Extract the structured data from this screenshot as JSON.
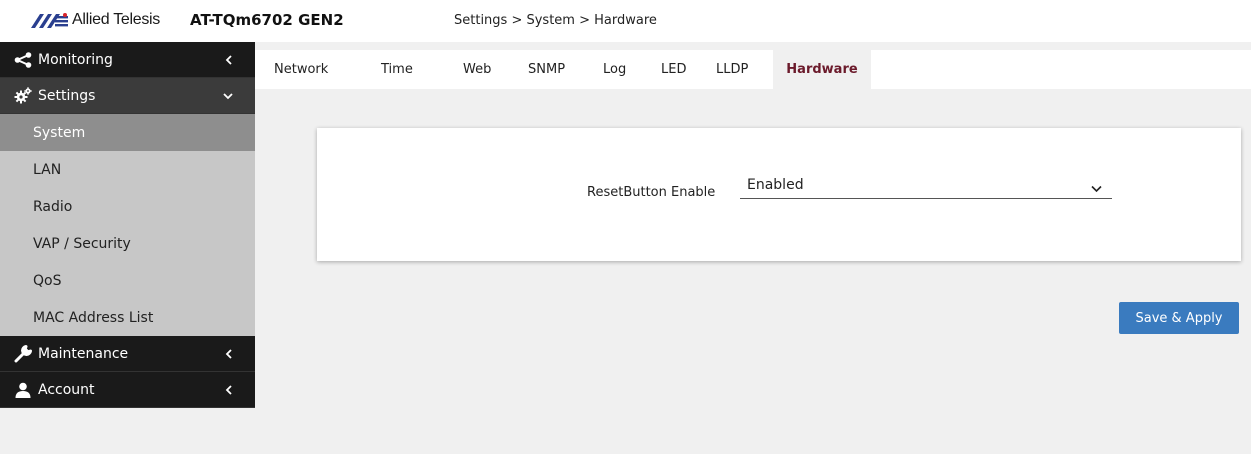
{
  "header": {
    "brand": "Allied Telesis",
    "model": "AT-TQm6702 GEN2",
    "breadcrumb": "Settings > System > Hardware"
  },
  "colors": {
    "sidebar_dark": "#1a1a1a",
    "sidebar_sub": "#c7c7c7",
    "sidebar_active": "#8e8e8e",
    "active_tab": "#6b1a2b",
    "apply_button": "#3a7bbf",
    "logo_blue": "#2a3f8f"
  },
  "sidebar": {
    "monitoring": {
      "label": "Monitoring",
      "icon": "share-icon"
    },
    "settings": {
      "label": "Settings",
      "icon": "gears-icon",
      "items": [
        {
          "label": "System"
        },
        {
          "label": "LAN"
        },
        {
          "label": "Radio"
        },
        {
          "label": "VAP / Security"
        },
        {
          "label": "QoS"
        },
        {
          "label": "MAC Address List"
        }
      ]
    },
    "maintenance": {
      "label": "Maintenance",
      "icon": "wrench-icon"
    },
    "account": {
      "label": "Account",
      "icon": "user-icon"
    }
  },
  "tabs": [
    {
      "label": "Network"
    },
    {
      "label": "Time"
    },
    {
      "label": "Web"
    },
    {
      "label": "SNMP"
    },
    {
      "label": "Log"
    },
    {
      "label": "LED"
    },
    {
      "label": "LLDP"
    },
    {
      "label": "Hardware"
    }
  ],
  "form": {
    "reset_label": "ResetButton Enable",
    "reset_value": "Enabled"
  },
  "actions": {
    "apply": "Save & Apply"
  }
}
